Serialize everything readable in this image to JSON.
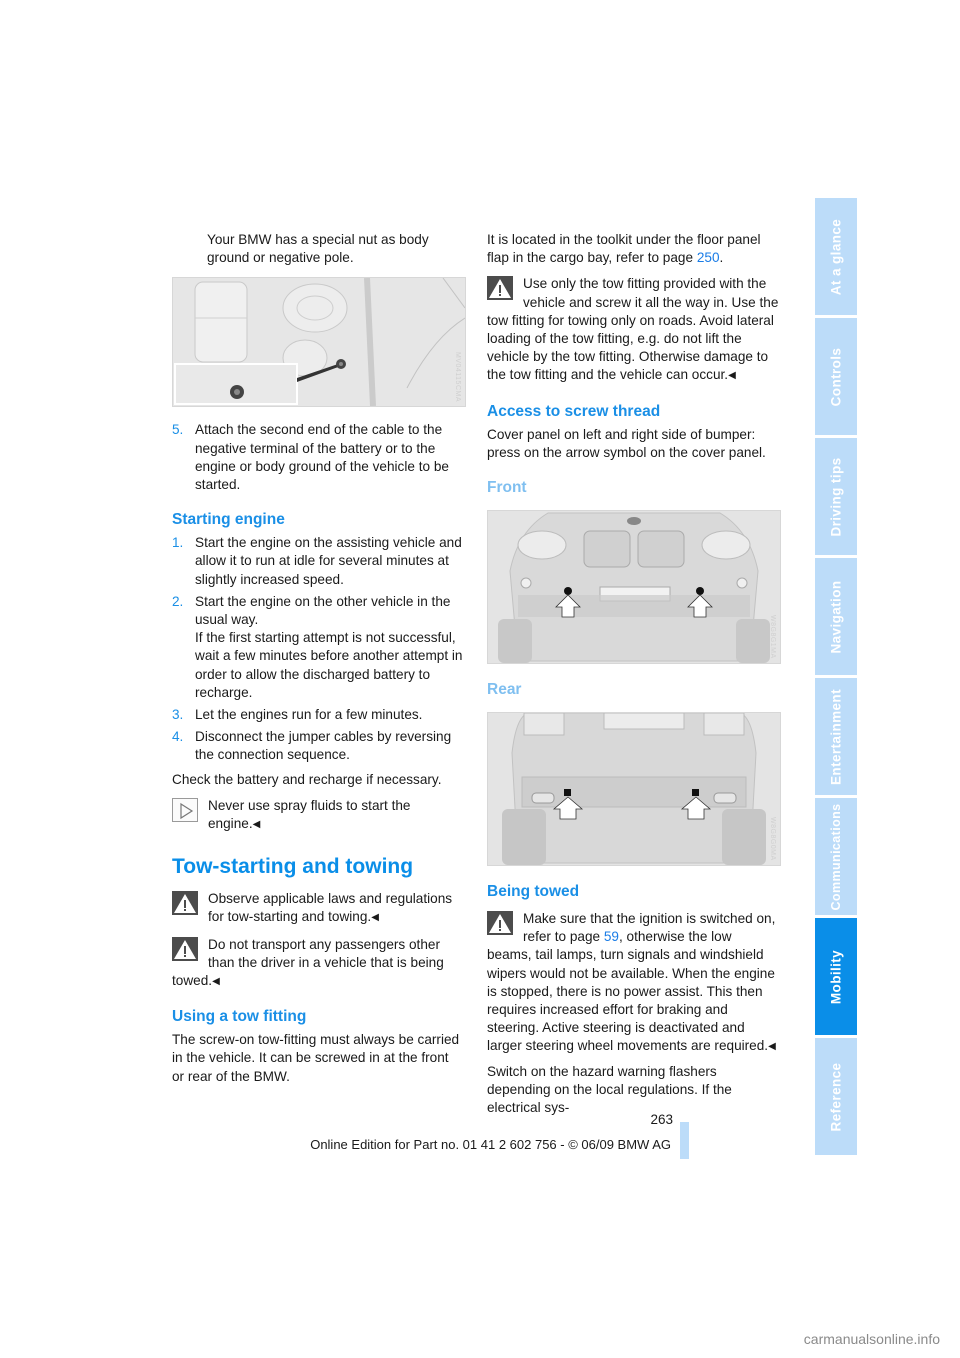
{
  "left_column": {
    "intro_text": "Your BMW has a special nut as body ground or negative pole.",
    "figure_engine": {
      "label": "engine-compartment-ground-nut-image",
      "watermark": "MV04115CMA"
    },
    "step5": {
      "num": "5.",
      "text": "Attach the second end of the cable to the negative terminal of the battery or to the engine or body ground of the vehicle to be started."
    },
    "starting_engine": {
      "heading": "Starting engine",
      "steps": [
        {
          "num": "1.",
          "text": "Start the engine on the assisting vehicle and allow it to run at idle for several minutes at slightly increased speed."
        },
        {
          "num": "2.",
          "text": "Start the engine on the other vehicle in the usual way.",
          "text2": "If the first starting attempt is not successful, wait a few minutes before another attempt in order to allow the discharged battery to recharge."
        },
        {
          "num": "3.",
          "text": "Let the engines run for a few minutes."
        },
        {
          "num": "4.",
          "text": "Disconnect the jumper cables by reversing the connection sequence."
        }
      ],
      "check_text": "Check the battery and recharge if necessary.",
      "note_text": "Never use spray fluids to start the engine.",
      "end_mark": "◀"
    },
    "tow_section": {
      "heading": "Tow-starting and towing",
      "warning1": "Observe applicable laws and regulations for tow-starting and towing.",
      "warning2": "Do not transport any passengers other than the driver in a vehicle that is being towed.",
      "end_mark": "◀"
    },
    "tow_fitting": {
      "heading": "Using a tow fitting",
      "text": "The screw-on tow-fitting must always be carried in the vehicle. It can be screwed in at the front or rear of the BMW."
    }
  },
  "right_column": {
    "location_text": "It is located in the toolkit under the floor panel flap in the cargo bay, refer to page ",
    "location_link": "250",
    "location_end": ".",
    "warning_text": "Use only the tow fitting provided with the vehicle and screw it all the way in. Use the tow fitting for towing only on roads. Avoid lateral loading of the tow fitting, e.g. do not lift the vehicle by the tow fitting. Otherwise damage to the tow fitting and the vehicle can occur.",
    "end_mark": "◀",
    "access": {
      "heading": "Access to screw thread",
      "text": "Cover panel on left and right side of bumper: press on the arrow symbol on the cover panel."
    },
    "front": {
      "heading": "Front",
      "watermark": "W8G8G1MA"
    },
    "rear": {
      "heading": "Rear",
      "watermark": "W8G8G0MA"
    },
    "being_towed": {
      "heading": "Being towed",
      "warning_pre": "Make sure that the ignition is switched on, refer to page ",
      "warning_link": "59",
      "warning_post": ", otherwise the low beams, tail lamps, turn signals and windshield wipers would not be available. When the engine is stopped, there is no power assist. This then requires increased effort for braking and steering. Active steering is deactivated and larger steering wheel movements are required.",
      "hazard_text": "Switch on the hazard warning flashers depending on the local regulations. If the electrical sys-"
    }
  },
  "side_tabs": [
    {
      "label": "At a glance",
      "active": false
    },
    {
      "label": "Controls",
      "active": false
    },
    {
      "label": "Driving tips",
      "active": false
    },
    {
      "label": "Navigation",
      "active": false
    },
    {
      "label": "Entertainment",
      "active": false
    },
    {
      "label": "Communications",
      "active": false
    },
    {
      "label": "Mobility",
      "active": true
    },
    {
      "label": "Reference",
      "active": false
    }
  ],
  "footer": {
    "page_number": "263",
    "edition": "Online Edition for Part no. 01 41 2 602 756 - © 06/09 BMW AG",
    "site": "carmanualsonline.info"
  },
  "colors": {
    "accent": "#0a8ee8",
    "tab_inactive": "#bcdcf9",
    "link": "#1a7ce6"
  }
}
